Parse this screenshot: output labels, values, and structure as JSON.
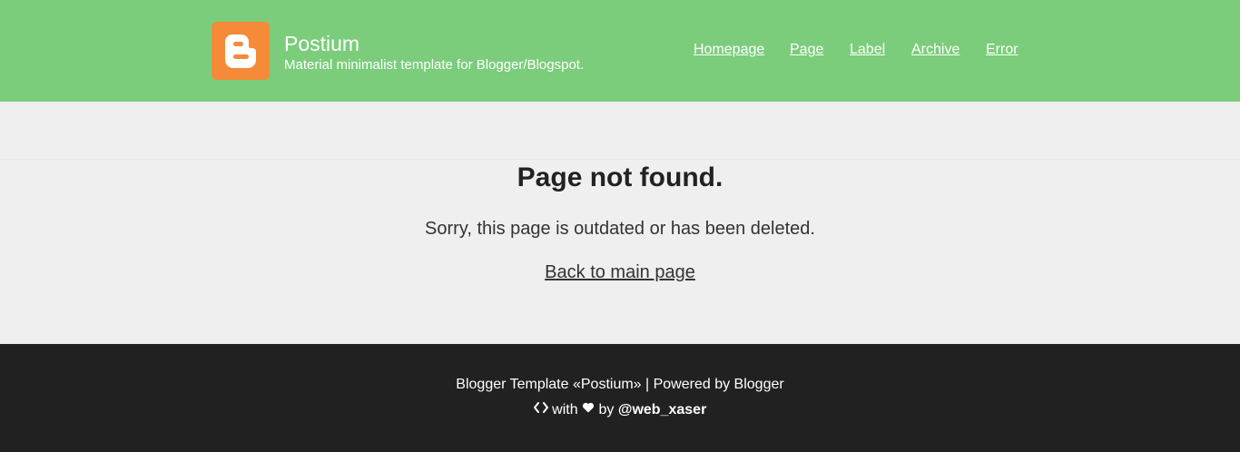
{
  "header": {
    "site_title": "Postium",
    "site_description": "Material minimalist template for Blogger/Blogspot.",
    "logo_icon": "blogger-logo-icon",
    "nav": [
      {
        "label": "Homepage"
      },
      {
        "label": "Page"
      },
      {
        "label": "Label"
      },
      {
        "label": "Archive"
      },
      {
        "label": "Error"
      }
    ]
  },
  "main": {
    "title": "Page not found.",
    "message": "Sorry, this page is outdated or has been deleted.",
    "back_link": "Back to main page"
  },
  "footer": {
    "line1": "Blogger Template «Postium» | Powered by Blogger",
    "with_text": "with",
    "by_text": "by",
    "author": "@web_xaser",
    "code_icon": "code-icon",
    "heart_icon": "heart-icon"
  },
  "colors": {
    "header_bg": "#7bcd7b",
    "page_bg": "#efefef",
    "footer_bg": "#212121",
    "logo_bg": "#f0883a"
  }
}
